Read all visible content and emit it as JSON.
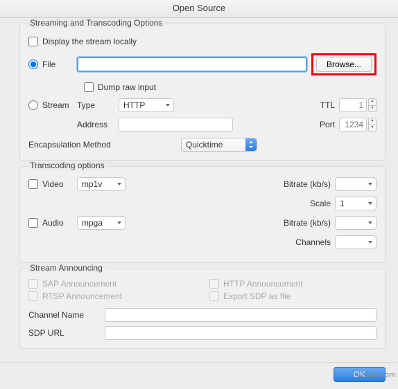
{
  "window_title": "Open Source",
  "streaming": {
    "title": "Streaming and Transcoding Options",
    "display_locally": "Display the stream locally",
    "file_label": "File",
    "browse": "Browse...",
    "dump_raw": "Dump raw input",
    "stream_label": "Stream",
    "type_label": "Type",
    "type_value": "HTTP",
    "ttl_label": "TTL",
    "ttl_value": "1",
    "address_label": "Address",
    "port_label": "Port",
    "port_placeholder": "1234",
    "encapsulation_label": "Encapsulation Method",
    "encapsulation_value": "Quicktime"
  },
  "transcoding": {
    "title": "Transcoding options",
    "video_label": "Video",
    "video_codec": "mp1v",
    "video_bitrate_label": "Bitrate (kb/s)",
    "scale_label": "Scale",
    "scale_value": "1",
    "audio_label": "Audio",
    "audio_codec": "mpga",
    "audio_bitrate_label": "Bitrate (kb/s)",
    "channels_label": "Channels"
  },
  "announcing": {
    "title": "Stream Announcing",
    "sap": "SAP Announcement",
    "rtsp": "RTSP Announcement",
    "http": "HTTP Announcement",
    "export_sdp": "Export SDP as file",
    "channel_name": "Channel Name",
    "sdp_url": "SDP URL"
  },
  "ok": "OK",
  "watermark": "wsxdn.com"
}
